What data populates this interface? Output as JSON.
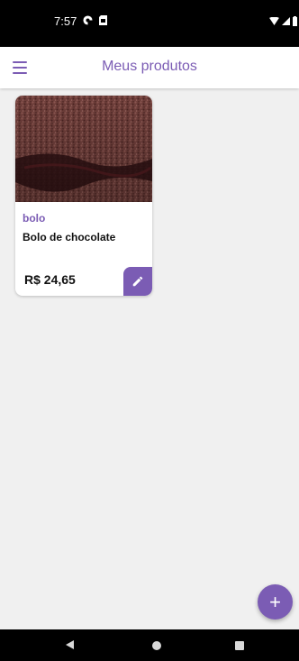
{
  "status_bar": {
    "time": "7:57",
    "left_icons": [
      "assistant-icon",
      "sim-card-icon"
    ],
    "right_icons": [
      "wifi-icon",
      "signal-icon",
      "battery-icon"
    ]
  },
  "app_bar": {
    "title": "Meus produtos",
    "menu_icon": "menu-icon"
  },
  "products": [
    {
      "category": "bolo",
      "name": "Bolo de chocolate",
      "price": "R$ 24,65",
      "edit_icon": "pencil-icon"
    }
  ],
  "fab": {
    "label": "+",
    "icon": "plus-icon"
  },
  "nav_bar": {
    "icons": [
      "back-icon",
      "home-icon",
      "recents-icon"
    ]
  },
  "colors": {
    "accent": "#7b5cb4",
    "background": "#f0f0f0",
    "surface": "#ffffff"
  }
}
